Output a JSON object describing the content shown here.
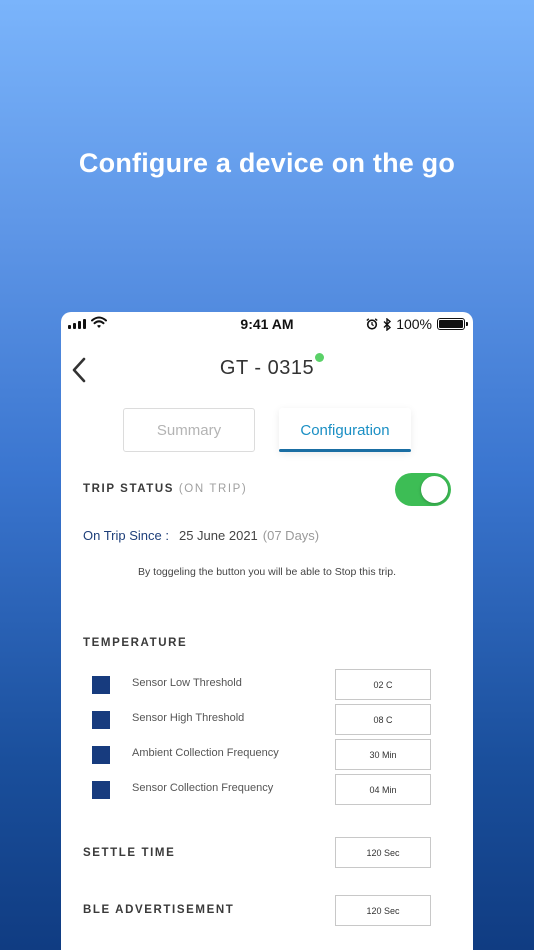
{
  "headline": "Configure a device on the go",
  "status_bar": {
    "time": "9:41 AM",
    "battery": "100%"
  },
  "device": {
    "title": "GT - 0315"
  },
  "tabs": {
    "summary": "Summary",
    "configuration": "Configuration",
    "active": "Configuration"
  },
  "trip": {
    "label": "TRIP STATUS",
    "state": "(ON TRIP)",
    "toggle_on": true,
    "since_label": "On Trip Since :",
    "since_date": "25 June 2021",
    "since_days": "(07 Days)",
    "hint": "By toggeling the button you will be able to Stop this trip."
  },
  "temperature": {
    "label": "TEMPERATURE",
    "rows": [
      {
        "label": "Sensor Low Threshold",
        "value": "02 C"
      },
      {
        "label": "Sensor High Threshold",
        "value": "08 C"
      },
      {
        "label": "Ambient Collection Frequency",
        "value": "30 Min"
      },
      {
        "label": "Sensor Collection Frequency",
        "value": "04 Min"
      }
    ]
  },
  "settle_time": {
    "label": "SETTLE TIME",
    "value": "120 Sec"
  },
  "ble_advertisement": {
    "label": "BLE ADVERTISEMENT",
    "value": "120 Sec"
  },
  "colors": {
    "accent": "#1a8fc4",
    "toggle": "#3dbd55",
    "legend_square": "#173b7e",
    "online": "#5ad168"
  },
  "icons": {
    "back": "chevron-left-icon",
    "signal": "cellular-signal-icon",
    "wifi": "wifi-icon",
    "alarm": "alarm-icon",
    "bluetooth": "bluetooth-icon",
    "battery": "battery-icon"
  }
}
